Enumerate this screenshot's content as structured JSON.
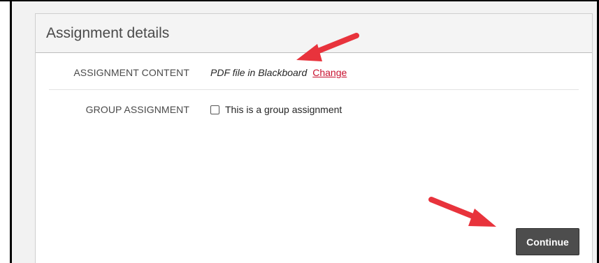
{
  "panel": {
    "title": "Assignment details"
  },
  "rows": [
    {
      "label": "ASSIGNMENT CONTENT",
      "value": "PDF file in Blackboard",
      "link": "Change"
    },
    {
      "label": "GROUP ASSIGNMENT",
      "checkbox_label": "This is a group assignment",
      "checked": false
    }
  ],
  "actions": {
    "continue_label": "Continue"
  },
  "colors": {
    "link": "#c8102e",
    "button": "#4d4d4d",
    "annotation_arrow": "#e8333c"
  }
}
